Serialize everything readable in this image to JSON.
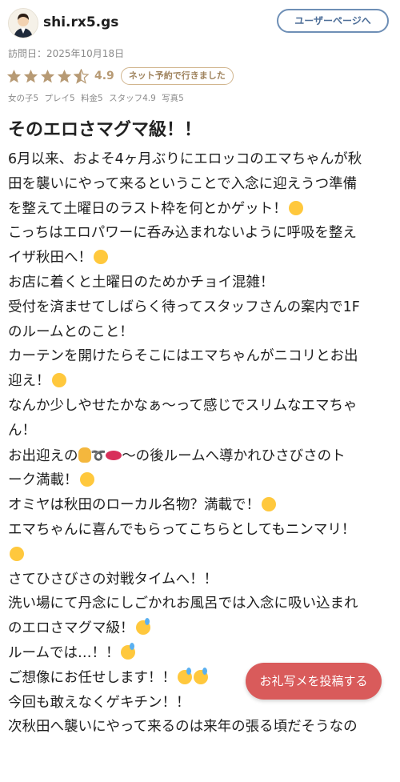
{
  "header": {
    "username": "shi.rx5.gs",
    "user_page_button": "ユーザーページへ"
  },
  "visit": {
    "label": "訪問日：2025年10月18日"
  },
  "rating": {
    "score_text": "4.9",
    "stars_value": 4.5,
    "stars_max": 5,
    "net_badge": "ネット予約で行きました",
    "subscores": [
      "女の子5",
      "プレイ5",
      "料金5",
      "スタッフ4.9",
      "写真5"
    ]
  },
  "review": {
    "title": "そのエロさマグマ級！！",
    "lines": [
      "6月以来、およそ4ヶ月ぶりにエロッコのエマちゃんが秋",
      "田を襲いにやって来るということで入念に迎えうつ準備",
      "を整えて土曜日のラスト枠を何とかゲット！",
      "こっちはエロパワーに呑み込まれないように呼吸を整え",
      "イザ秋田へ！",
      "お店に着くと土曜日のためかチョイ混雑！",
      "受付を済ませてしばらく待ってスタッフさんの案内で1F",
      "のルームとのこと！",
      "カーテンを開けたらそこにはエマちゃんがニコリとお出",
      "迎え！",
      "なんか少しやせたかなぁ〜って感じでスリムなエマちゃ",
      "ん！",
      "お出迎えの",
      "〜の後ルームへ導かれひさびさのト",
      "ーク満載！",
      "オミヤは秋田のローカル名物？満載で！",
      "エマちゃんに喜んでもらってこちらとしてもニンマリ！",
      "さてひさびさの対戦タイムへ！！",
      "洗い場にて丹念にしごかれお風呂では入念に吸い込まれ",
      "のエロさマグマ級！",
      "ルームでは…！！",
      "ご想像にお任せします！！",
      "今回も敢えなくゲキチン！！",
      "次秋田へ襲いにやって来るのは来年の張る頃だそうなの"
    ]
  },
  "actions": {
    "post_button": "お礼写メを投稿する"
  },
  "icons": {
    "star_color": "#b79a74",
    "star_empty_color": "#dcd6cc",
    "emoji_color": "#ffc83d",
    "accent_red": "#d95b5b",
    "link_blue": "#4d6e98"
  }
}
